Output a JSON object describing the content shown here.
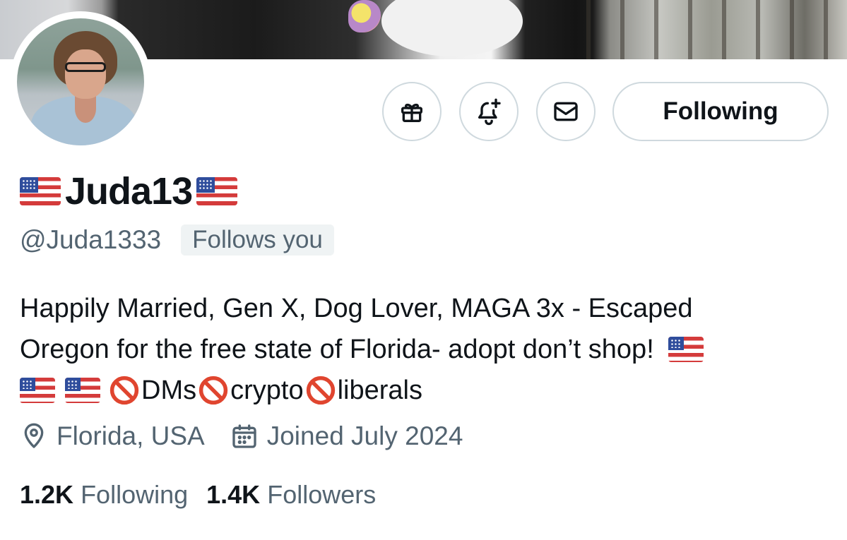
{
  "profile": {
    "display_name": "Juda13",
    "handle": "@Juda1333",
    "follows_you_label": "Follows you",
    "bio": {
      "line1": "Happily Married, Gen X, Dog Lover, MAGA 3x - Escaped",
      "line2": "Oregon for the free state of Florida- adopt don’t shop!",
      "tag1": "DMs",
      "tag2": "crypto",
      "tag3": "liberals"
    },
    "location": "Florida, USA",
    "joined": "Joined July 2024",
    "stats": {
      "following_count": "1.2K",
      "following_label": "Following",
      "followers_count": "1.4K",
      "followers_label": "Followers"
    }
  },
  "actions": {
    "gift_icon": "gift-icon",
    "notify_icon": "bell-plus-icon",
    "message_icon": "envelope-icon",
    "follow_state_label": "Following"
  },
  "colors": {
    "text_primary": "#0f1419",
    "text_secondary": "#536471",
    "border": "#cfd9de",
    "badge_bg": "#eff3f4"
  }
}
